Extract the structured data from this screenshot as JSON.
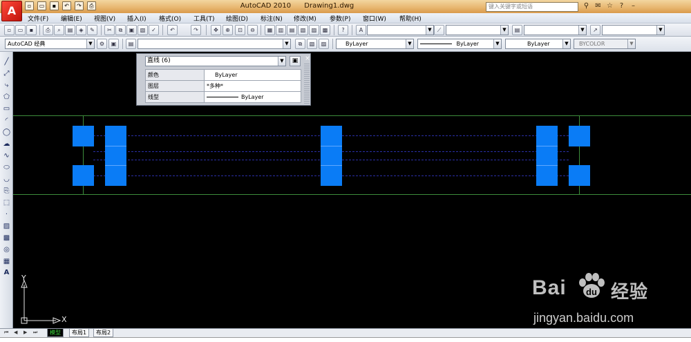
{
  "titlebar": {
    "app_title": "AutoCAD 2010",
    "document": "Drawing1.dwg",
    "search_placeholder": "键入关键字或短语"
  },
  "menu": [
    "文件(F)",
    "编辑(E)",
    "视图(V)",
    "插入(I)",
    "格式(O)",
    "工具(T)",
    "绘图(D)",
    "标注(N)",
    "修改(M)",
    "参数(P)",
    "窗口(W)",
    "帮助(H)"
  ],
  "toolbar2": {
    "workspace": "AutoCAD 经典",
    "color": "ByLayer",
    "linetype": "ByLayer",
    "lineweight": "ByLayer",
    "plotstyle": "BYCOLOR"
  },
  "properties": {
    "selection": "直线 (6)",
    "rows": [
      {
        "key": "颜色",
        "value": "ByLayer"
      },
      {
        "key": "图层",
        "value": "*多种*"
      },
      {
        "key": "线型",
        "value": "ByLayer"
      }
    ]
  },
  "ucs": {
    "x": "X",
    "y": "Y"
  },
  "tabs": [
    "模型",
    "布局1",
    "布局2"
  ],
  "watermark": {
    "brand_left": "Bai",
    "brand_right": "经验",
    "url": "jingyan.baidu.com"
  },
  "colors": {
    "canvas": "#000000",
    "construction_line": "#3d8e3c",
    "block": "#0a7cf6",
    "hidden_line": "#2a2fa8"
  }
}
